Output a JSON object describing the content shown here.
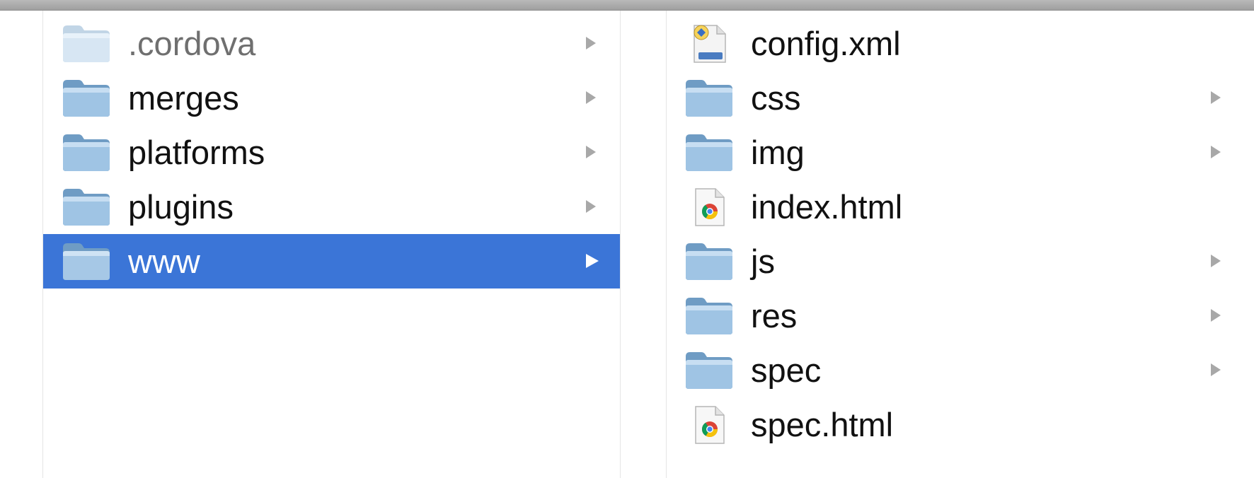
{
  "columns": [
    {
      "items": [
        {
          "name": ".cordova",
          "kind": "folder",
          "has_children": true,
          "dimmed": true,
          "selected": false
        },
        {
          "name": "merges",
          "kind": "folder",
          "has_children": true,
          "dimmed": false,
          "selected": false
        },
        {
          "name": "platforms",
          "kind": "folder",
          "has_children": true,
          "dimmed": false,
          "selected": false
        },
        {
          "name": "plugins",
          "kind": "folder",
          "has_children": true,
          "dimmed": false,
          "selected": false
        },
        {
          "name": "www",
          "kind": "folder",
          "has_children": true,
          "dimmed": false,
          "selected": true
        }
      ]
    },
    {
      "items": [
        {
          "name": "config.xml",
          "kind": "xml-file",
          "has_children": false,
          "selected": false
        },
        {
          "name": "css",
          "kind": "folder",
          "has_children": true,
          "selected": false
        },
        {
          "name": "img",
          "kind": "folder",
          "has_children": true,
          "selected": false
        },
        {
          "name": "index.html",
          "kind": "html-file",
          "has_children": false,
          "selected": false
        },
        {
          "name": "js",
          "kind": "folder",
          "has_children": true,
          "selected": false
        },
        {
          "name": "res",
          "kind": "folder",
          "has_children": true,
          "selected": false
        },
        {
          "name": "spec",
          "kind": "folder",
          "has_children": true,
          "selected": false
        },
        {
          "name": "spec.html",
          "kind": "html-file",
          "has_children": false,
          "selected": false
        }
      ]
    }
  ],
  "colors": {
    "selection": "#3b75d7",
    "text": "#111111",
    "dimmed_text": "#6f6f6f",
    "disclosure_arrow": "#a8a8a8"
  }
}
